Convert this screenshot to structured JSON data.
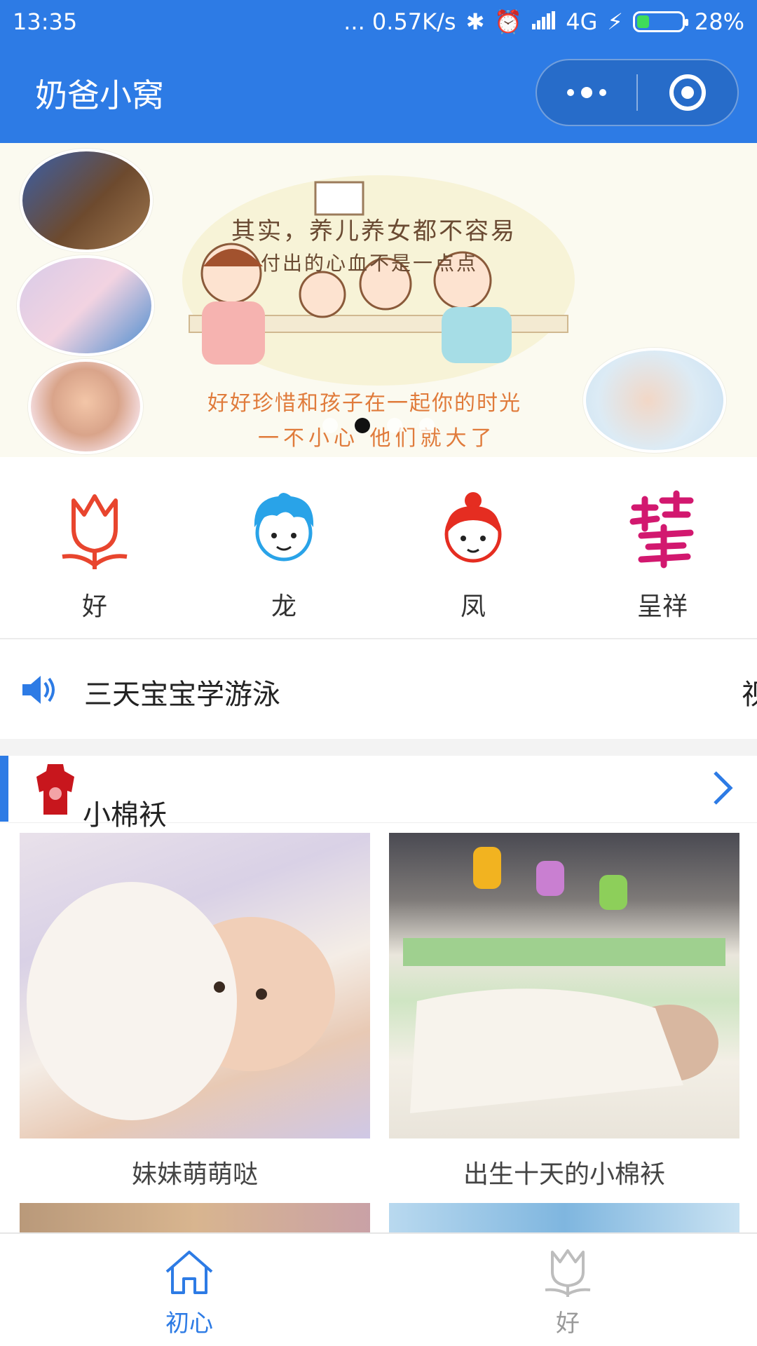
{
  "status_bar": {
    "time": "13:35",
    "net_speed": "... 0.57K/s",
    "network": "4G",
    "battery": "28%",
    "battery_level": 0.28
  },
  "nav": {
    "title": "奶爸小窝"
  },
  "banner": {
    "headline": "其实，养儿养女都不容易",
    "subline": "付出的心血不是一点点",
    "line1": "好好珍惜和孩子在一起你的时光",
    "line2": "一不小心 他们就大了",
    "page_count": 4,
    "active_page": 2
  },
  "categories": [
    {
      "label": "好",
      "icon": "tulip-icon"
    },
    {
      "label": "龙",
      "icon": "boy-face-icon"
    },
    {
      "label": "凤",
      "icon": "girl-face-icon"
    },
    {
      "label": "呈祥",
      "icon": "auspicious-calligraphy-icon"
    }
  ],
  "notice": {
    "text": "三天宝宝学游泳",
    "tail": "视"
  },
  "section": {
    "title": "小棉袄"
  },
  "cards": [
    {
      "caption": "妹妹萌萌哒"
    },
    {
      "caption": "出生十天的小棉袄"
    }
  ],
  "tabbar": {
    "tabs": [
      {
        "label": "初心",
        "icon": "home-icon",
        "active": true
      },
      {
        "label": "好",
        "icon": "tulip-icon",
        "active": false
      }
    ]
  },
  "colors": {
    "brand": "#2d7be5",
    "tulip_red": "#e8452e",
    "boy_blue": "#29a3e8",
    "girl_red": "#e52d21",
    "calligraphy_pink": "#d2186f"
  }
}
